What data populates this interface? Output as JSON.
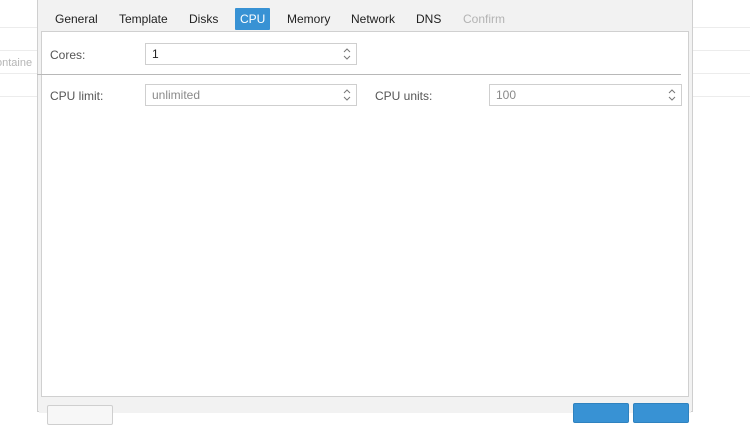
{
  "background": {
    "partial_label": "ontaine"
  },
  "tabs": [
    {
      "label": "General",
      "state": "normal"
    },
    {
      "label": "Template",
      "state": "normal"
    },
    {
      "label": "Disks",
      "state": "normal"
    },
    {
      "label": "CPU",
      "state": "active"
    },
    {
      "label": "Memory",
      "state": "normal"
    },
    {
      "label": "Network",
      "state": "normal"
    },
    {
      "label": "DNS",
      "state": "normal"
    },
    {
      "label": "Confirm",
      "state": "disabled"
    }
  ],
  "form": {
    "cores_label": "Cores:",
    "cores_value": "1",
    "cpu_limit_label": "CPU limit:",
    "cpu_limit_value": "unlimited",
    "cpu_units_label": "CPU units:",
    "cpu_units_value": "100"
  },
  "colors": {
    "accent": "#3892d4",
    "dialog_bg": "#f2f2f2",
    "panel_bg": "#ffffff"
  },
  "icons": {
    "spinner": "spinner-up-down-icon"
  }
}
